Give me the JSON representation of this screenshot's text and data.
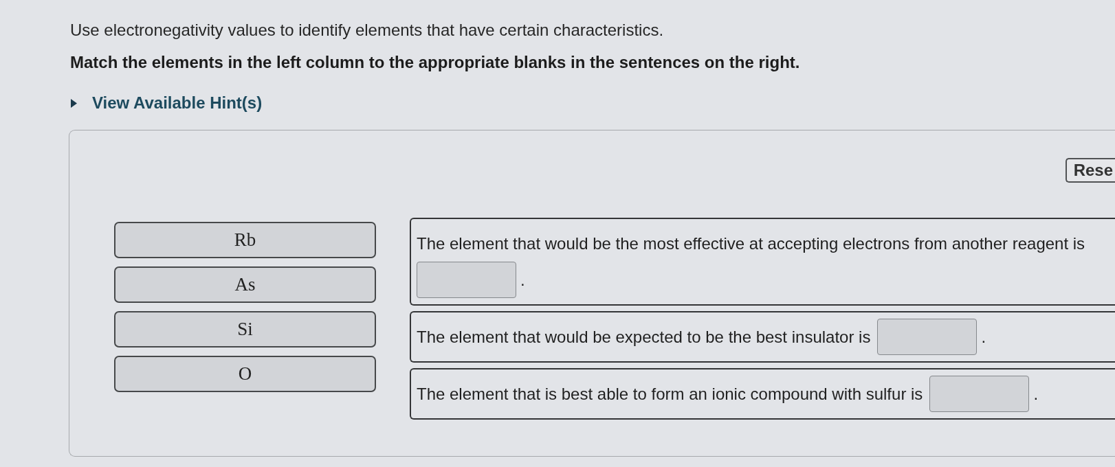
{
  "instructions": {
    "intro": "Use electronegativity values to identify elements that have certain characteristics.",
    "task": "Match the elements in the left column to the appropriate blanks in the sentences on the right."
  },
  "hints": {
    "label": "View Available Hint(s)",
    "expanded": false
  },
  "panel": {
    "reset_button": "Rese",
    "tiles": [
      "Rb",
      "As",
      "Si",
      "O"
    ],
    "sentences": [
      {
        "text": "The element that would be the most effective at accepting electrons from another reagent is",
        "end": "."
      },
      {
        "text": "The element that would be expected to be the best insulator is",
        "end": "."
      },
      {
        "text": "The element that is best able to form an ionic compound with sulfur is",
        "end": "."
      }
    ]
  }
}
